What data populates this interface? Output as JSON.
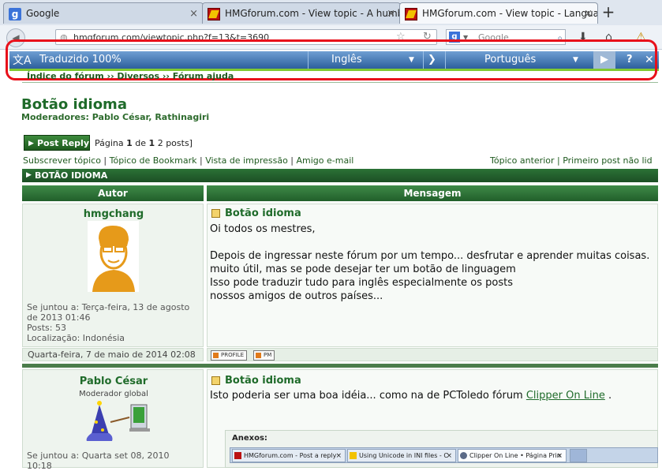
{
  "browser": {
    "tabs": [
      {
        "label": "Google",
        "favicon": "google-favicon"
      },
      {
        "label": "HMGforum.com - View topic - A humble re...",
        "favicon": "hmg-favicon"
      },
      {
        "label": "HMGforum.com - View topic - Language B...",
        "favicon": "hmg-favicon",
        "active": true
      }
    ],
    "new_tab": "+",
    "close_glyph": "×",
    "url": "hmgforum.com/viewtopic.php?f=13&t=3690",
    "search_engine": "g",
    "search_placeholder": "Google"
  },
  "translate_bar": {
    "status": "Traduzido 100%",
    "source_lang": "Inglês",
    "target_lang": "Português",
    "help": "?",
    "close": "✕"
  },
  "forum": {
    "breadcrumb": "Índice do fórum ›› Diversos ›› Fórum ajuda",
    "topic_title": "Botão idioma",
    "moderators": "Moderadores: Pablo César, Rathinagiri",
    "post_reply": "Post Reply",
    "pagination": {
      "prefix": "Página ",
      "current": "1",
      "middle": " de ",
      "total": "1",
      "suffix": " 2 posts]"
    },
    "actions": {
      "subscribe": "Subscrever tópico",
      "bookmark": "Tópico de Bookmark",
      "print": "Vista de impressão",
      "email": "Amigo e-mail",
      "sep": " | ",
      "right": "Tópico anterior | Primeiro post não lid"
    },
    "topic_bar": "BOTÃO IDIOMA",
    "columns": {
      "author": "Autor",
      "message": "Mensagem"
    },
    "posts": [
      {
        "author": "hmgchang",
        "title": "Botão idioma",
        "body": [
          "Oi todos os mestres,",
          "",
          "Depois de ingressar neste fórum por um tempo... desfrutar e aprender muitas coisas.",
          "muito útil, mas se pode desejar ter um botão de linguagem",
          "Isso pode traduzir tudo para inglês especialmente os posts",
          "nossos amigos de outros países..."
        ],
        "joined": "Se juntou a: Terça-feira, 13 de agosto de 2013 01:46",
        "posts": "Posts: 53",
        "location": "Localização: Indonésia",
        "date": "Quarta-feira, 7 de maio de 2014 02:08",
        "buttons": [
          "PROFILE",
          "PM"
        ]
      },
      {
        "author": "Pablo César",
        "role": "Moderador global",
        "title": "Botão idioma",
        "body_text": "Isto poderia ser uma boa idéia... como na de PCToledo fórum ",
        "body_link": "Clipper On Line",
        "body_end": " .",
        "joined": "Se juntou a: Quarta set 08, 2010 10:18",
        "attachments_label": "Anexos:",
        "attachment_tabs": [
          {
            "label": "HMGforum.com - Post a reply",
            "icon": "hmg"
          },
          {
            "label": "Using Unicode in INI files - C",
            "icon": "u"
          },
          {
            "label": "Clipper On Line • Página Prin",
            "icon": "c"
          }
        ]
      }
    ]
  },
  "colors": {
    "forum_green": "#1f6b2a",
    "translate_blue": "#2c5f9c",
    "annotation_red": "#e8101a",
    "accent_green": "#7fc832"
  }
}
